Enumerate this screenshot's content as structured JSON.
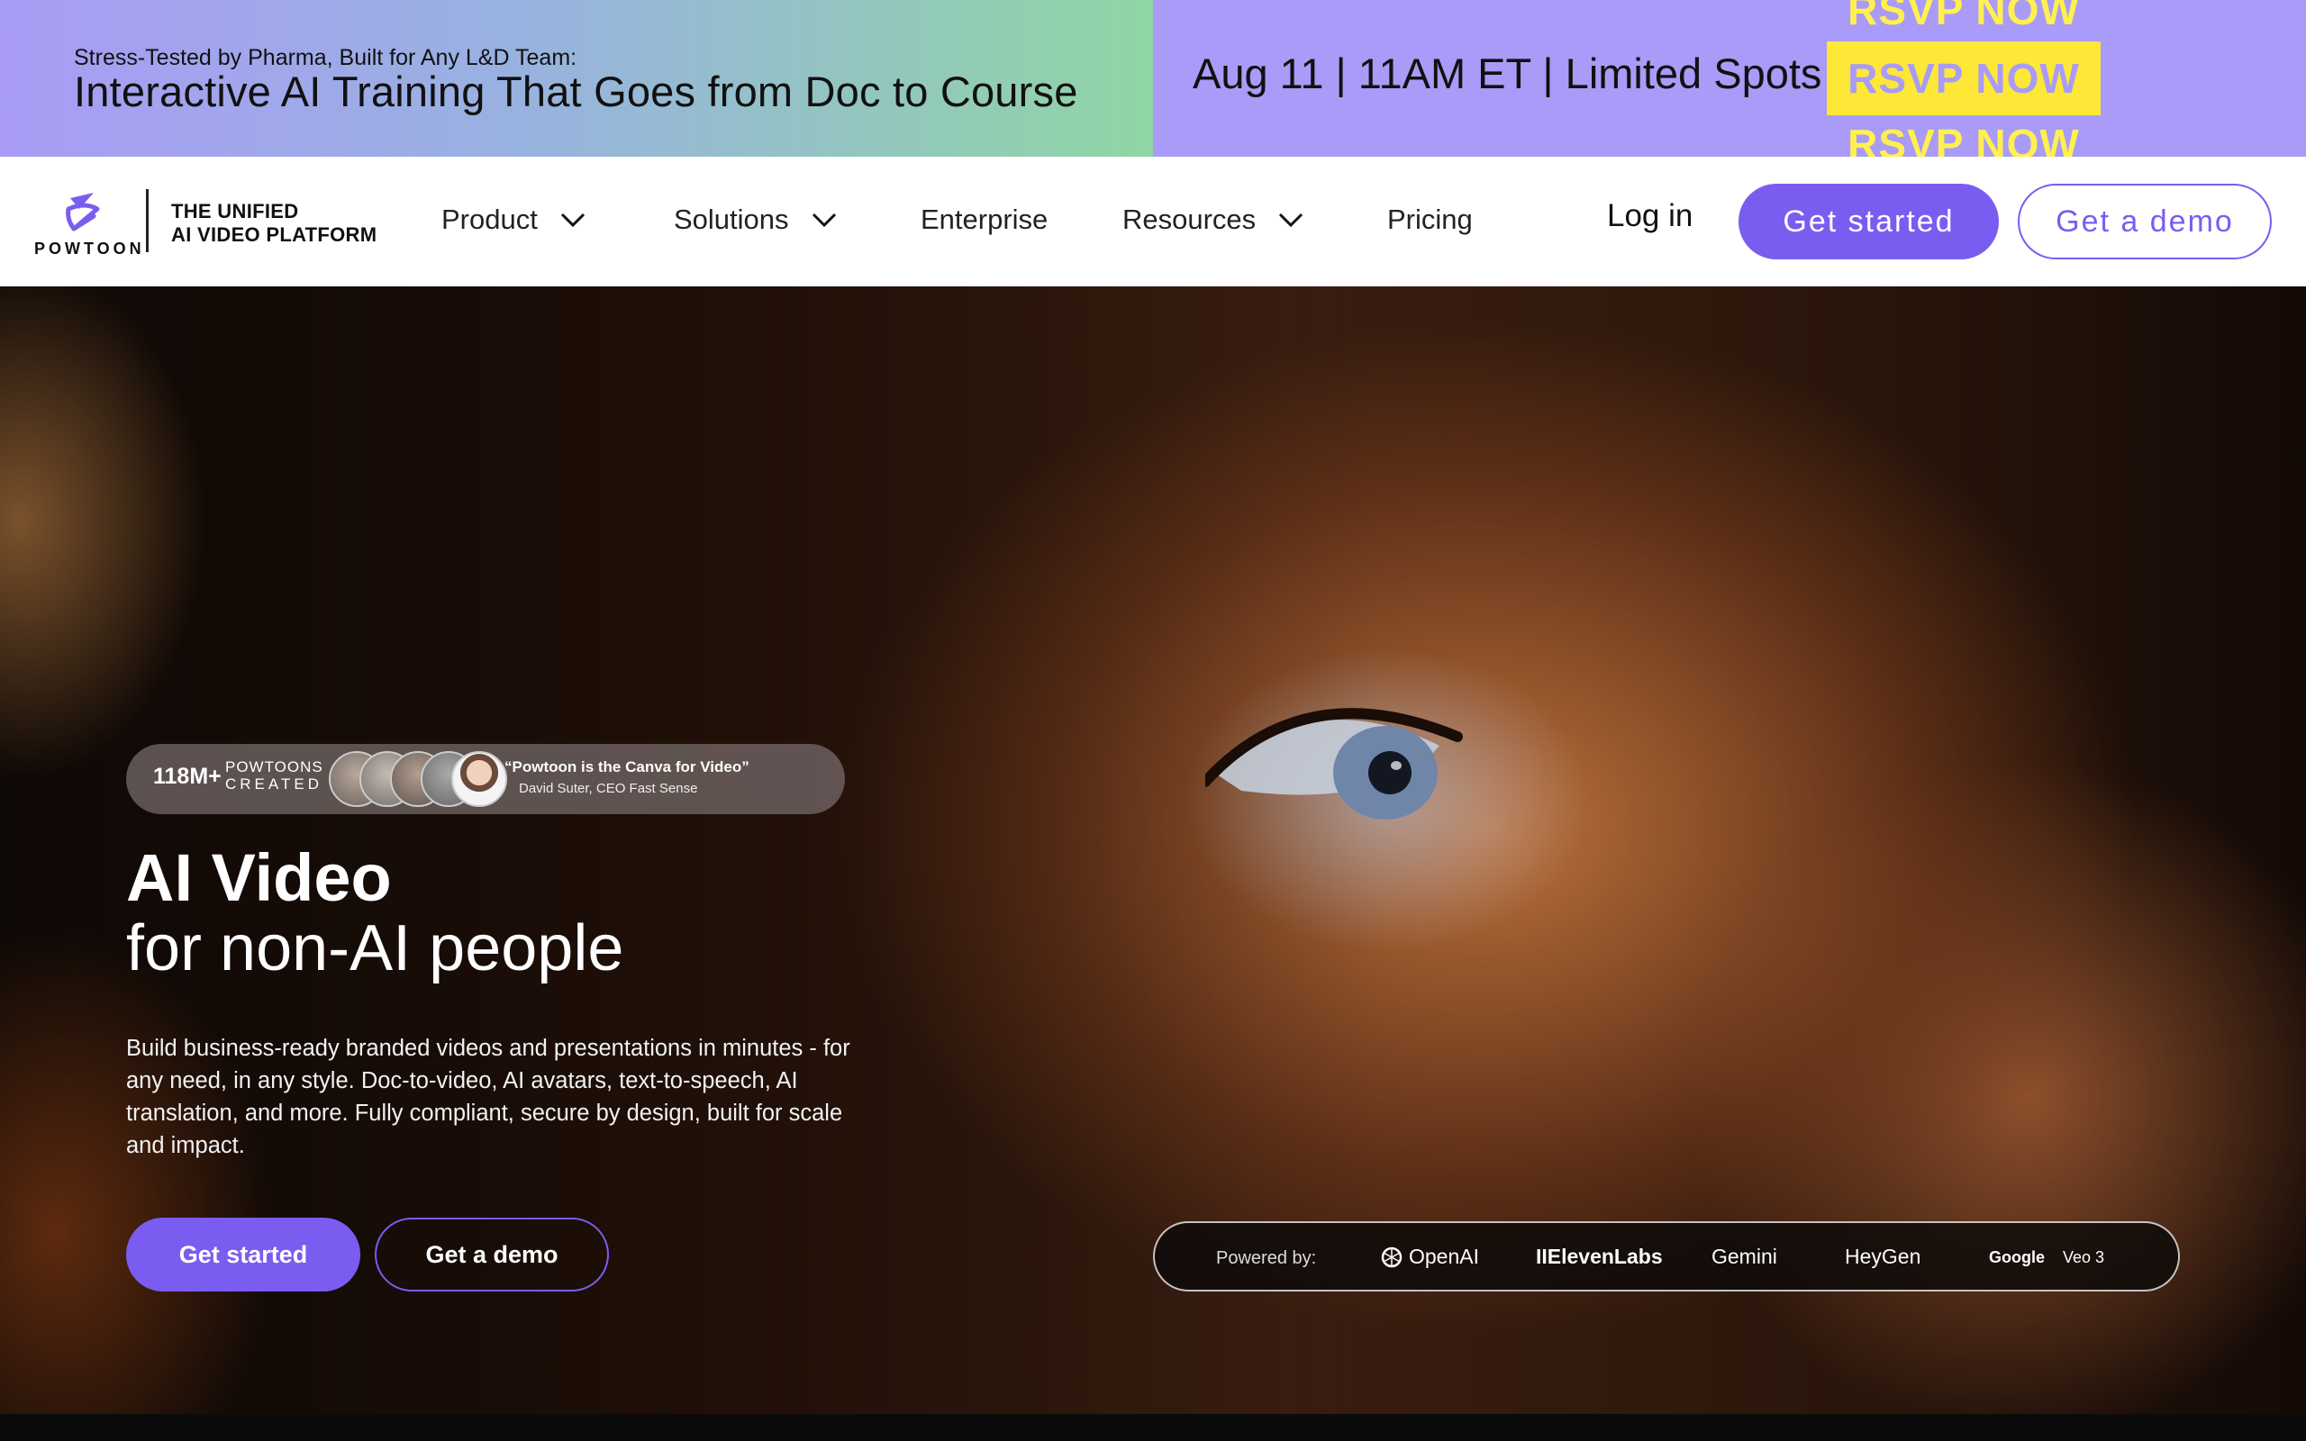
{
  "promo": {
    "kicker": "Stress-Tested by Pharma, Built for Any L&D Team:",
    "title": "Interactive AI Training That Goes from Doc to Course",
    "event": "Aug 11 | 11AM ET | Limited Spots",
    "rsvp_label": "RSVP NOW",
    "colors": {
      "accent_bg": "#a99bf7",
      "rsvp_bg": "#fde737"
    }
  },
  "nav": {
    "logo_text": "POWTOON",
    "tagline_line1": "THE UNIFIED",
    "tagline_line2": "AI VIDEO PLATFORM",
    "items": [
      {
        "label": "Product",
        "has_dropdown": true
      },
      {
        "label": "Solutions",
        "has_dropdown": true
      },
      {
        "label": "Enterprise",
        "has_dropdown": false
      },
      {
        "label": "Resources",
        "has_dropdown": true
      },
      {
        "label": "Pricing",
        "has_dropdown": false
      }
    ],
    "login": "Log in",
    "get_started": "Get started",
    "get_demo": "Get a demo",
    "colors": {
      "brand": "#7b5cf0"
    }
  },
  "hero": {
    "social": {
      "count": "118M+",
      "label_line1": "POWTOONS",
      "label_line2": "CREATED",
      "quote": "“Powtoon is the Canva for Video”",
      "quote_author": "David Suter, CEO Fast Sense"
    },
    "headline_bold": "AI Video",
    "headline_light": "for non-AI people",
    "description": "Build business-ready branded videos and presentations in minutes - for any need, in any style. Doc-to-video, AI avatars, text-to-speech, AI translation, and more. Fully compliant, secure by design, built for scale and impact.",
    "get_started": "Get started",
    "get_demo": "Get a demo",
    "powered_by": {
      "label": "Powered by:",
      "partners": [
        "OpenAI",
        "IIElevenLabs",
        "Gemini",
        "HeyGen",
        "Google",
        "Veo 3"
      ]
    }
  }
}
